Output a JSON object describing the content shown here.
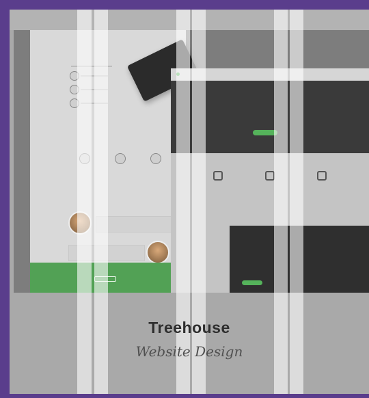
{
  "project": {
    "title": "Treehouse",
    "category": "Website Design"
  },
  "colors": {
    "frame": "#5a3d8c",
    "overlay": "#a9a9a9",
    "accent_green": "#55b35b"
  }
}
